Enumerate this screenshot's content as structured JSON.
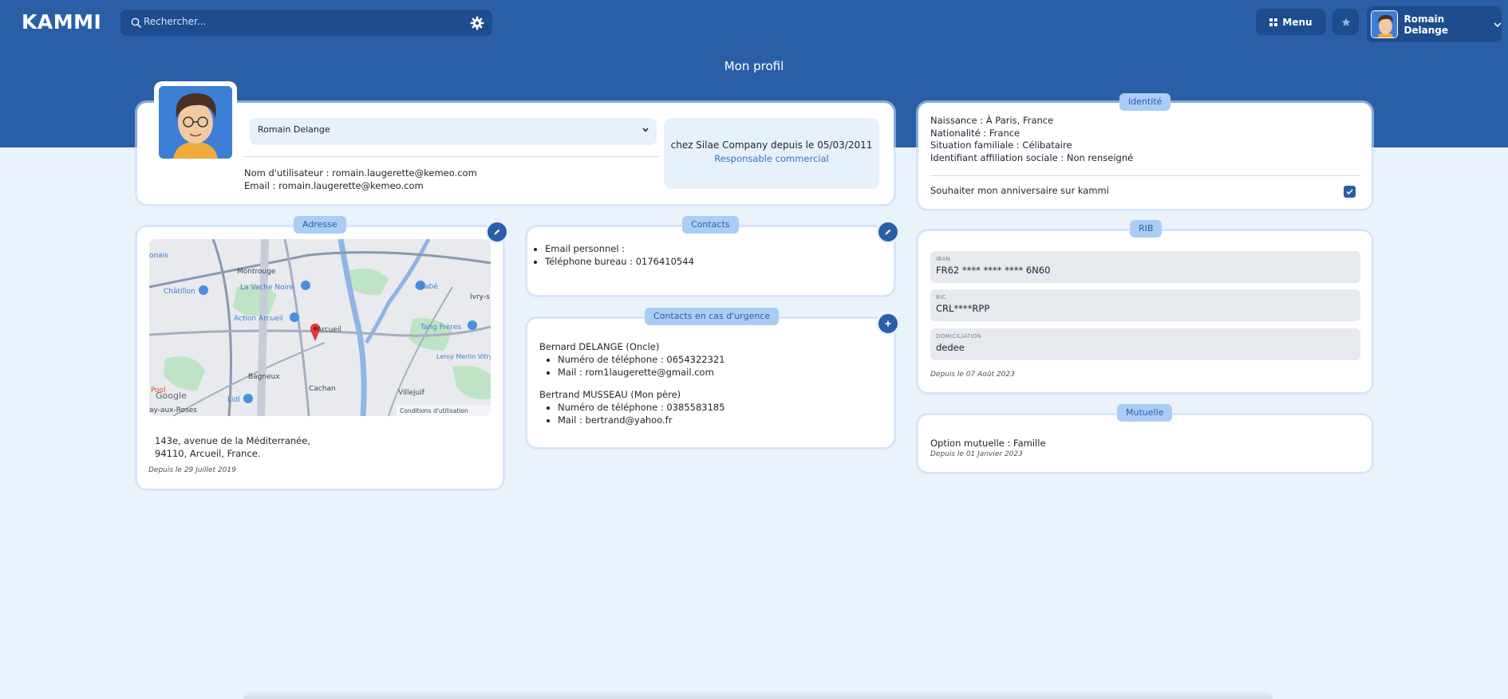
{
  "app": {
    "logo": "KAMMI"
  },
  "search": {
    "placeholder": "Rechercher..."
  },
  "header": {
    "menu_label": "Menu",
    "user_name": "Romain Delange"
  },
  "page": {
    "title": "Mon profil"
  },
  "profile": {
    "selected_user": "Romain Delange",
    "username_line": "Nom d'utilisateur : romain.laugerette@kemeo.com",
    "email_line": "Email : romain.laugerette@kemeo.com",
    "company_line": "chez Silae Company depuis le 05/03/2011",
    "role": "Responsable commercial"
  },
  "identity": {
    "title": "Identité",
    "lines": [
      "Naissance : À Paris, France",
      "Nationalité : France",
      "Situation familiale : Célibataire",
      "Identifiant affiliation sociale : Non renseigné"
    ],
    "birthday_label": "Souhaiter mon anniversaire sur kammi",
    "birthday_checked": true
  },
  "address": {
    "title": "Adresse",
    "line1": "143e, avenue de la Méditerranée,",
    "line2": "94110, Arcueil, France.",
    "since": "Depuis le 29 Juillet 2019",
    "map": {
      "labels": [
        "Montrouge",
        "La Vache Noire",
        "Châtillon",
        "Action Arcueil",
        "Arcueil",
        "Bagneux",
        "Cachan",
        "Villejuif",
        "Ivry-s",
        "Tang Frères",
        "Okabé",
        "Leroy Merlin Vitry-sur-Seine",
        "Lidl",
        "Pool",
        "ay-aux-Roses",
        "onais"
      ],
      "google": "Google",
      "terms": "Conditions d'utilisation"
    }
  },
  "contacts": {
    "title": "Contacts",
    "items": [
      "Email personnel :",
      "Téléphone bureau : 0176410544"
    ]
  },
  "emergency": {
    "title": "Contacts en cas d'urgence",
    "people": [
      {
        "name": "Bernard DELANGE (Oncle)",
        "phone": "Numéro de téléphone : 0654322321",
        "mail": "Mail : rom1laugerette@gmail.com"
      },
      {
        "name": "Bertrand MUSSEAU (Mon père)",
        "phone": "Numéro de téléphone : 0385583185",
        "mail": "Mail : bertrand@yahoo.fr"
      }
    ]
  },
  "rib": {
    "title": "RIB",
    "iban_label": "IBAN",
    "iban": "FR62 **** **** **** 6N60",
    "bic_label": "BIC",
    "bic": "CRL****RPP",
    "domiciliation_label": "DOMICILIATION",
    "domiciliation": "dedee",
    "since": "Depuis le 07 Août 2023"
  },
  "mutuelle": {
    "title": "Mutuelle",
    "option": "Option mutuelle : Famille",
    "since": "Depuis le 01 Janvier 2023"
  },
  "colors": {
    "brand": "#2a5fa8",
    "brand_dark": "#1d4c8f",
    "background": "#eaf3fc",
    "pill": "#a9cdf5"
  }
}
